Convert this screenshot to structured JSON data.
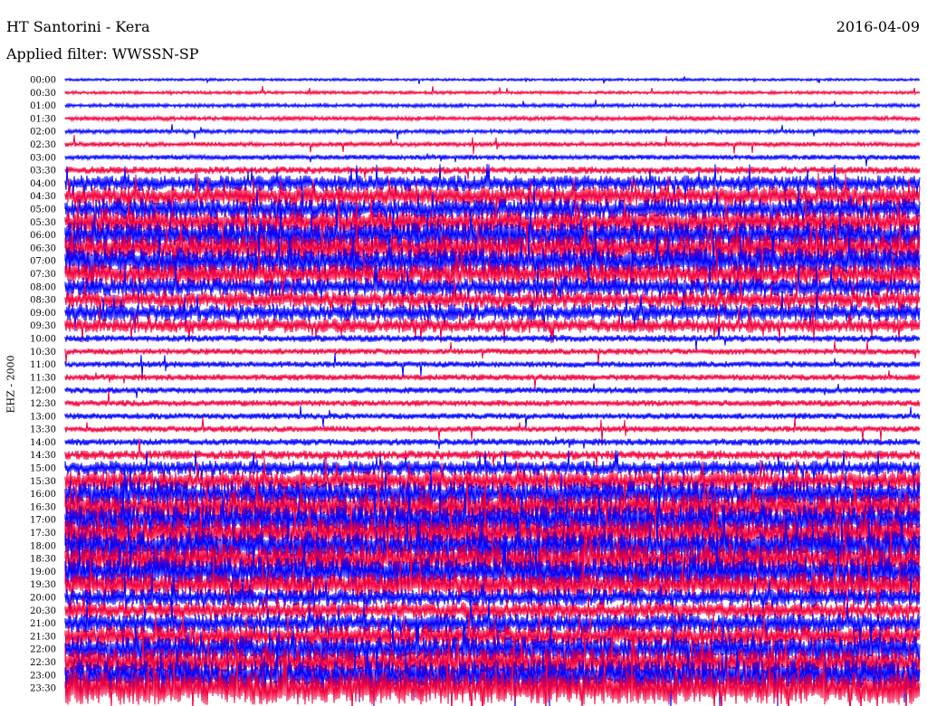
{
  "header": {
    "title": "HT Santorini - Kera",
    "date": "2016-04-09",
    "filter": "Applied filter: WWSSN-SP"
  },
  "chart_data": {
    "type": "line",
    "title": "HT Santorini - Kera",
    "ylabel": "EHZ - 2000",
    "colors": {
      "odd": "#0000ff",
      "even": "#f2003c"
    },
    "rows": [
      {
        "label": "00:00",
        "amp": 0.05
      },
      {
        "label": "00:30",
        "amp": 0.1
      },
      {
        "label": "01:00",
        "amp": 0.15
      },
      {
        "label": "01:30",
        "amp": 0.2
      },
      {
        "label": "02:00",
        "amp": 0.2
      },
      {
        "label": "02:30",
        "amp": 0.22
      },
      {
        "label": "03:00",
        "amp": 0.25
      },
      {
        "label": "03:30",
        "amp": 0.45
      },
      {
        "label": "04:00",
        "amp": 1.1
      },
      {
        "label": "04:30",
        "amp": 1.4
      },
      {
        "label": "05:00",
        "amp": 1.5
      },
      {
        "label": "05:30",
        "amp": 1.7
      },
      {
        "label": "06:00",
        "amp": 1.9
      },
      {
        "label": "06:30",
        "amp": 2.0
      },
      {
        "label": "07:00",
        "amp": 2.0
      },
      {
        "label": "07:30",
        "amp": 1.6
      },
      {
        "label": "08:00",
        "amp": 1.3
      },
      {
        "label": "08:30",
        "amp": 1.2
      },
      {
        "label": "09:00",
        "amp": 1.2
      },
      {
        "label": "09:30",
        "amp": 1.0
      },
      {
        "label": "10:00",
        "amp": 0.4
      },
      {
        "label": "10:30",
        "amp": 0.35
      },
      {
        "label": "11:00",
        "amp": 0.35
      },
      {
        "label": "11:30",
        "amp": 0.35
      },
      {
        "label": "12:00",
        "amp": 0.35
      },
      {
        "label": "12:30",
        "amp": 0.35
      },
      {
        "label": "13:00",
        "amp": 0.35
      },
      {
        "label": "13:30",
        "amp": 0.35
      },
      {
        "label": "14:00",
        "amp": 0.4
      },
      {
        "label": "14:30",
        "amp": 0.6
      },
      {
        "label": "15:00",
        "amp": 1.0
      },
      {
        "label": "15:30",
        "amp": 1.5
      },
      {
        "label": "16:00",
        "amp": 1.9
      },
      {
        "label": "16:30",
        "amp": 2.1
      },
      {
        "label": "17:00",
        "amp": 2.2
      },
      {
        "label": "17:30",
        "amp": 2.2
      },
      {
        "label": "18:00",
        "amp": 2.2
      },
      {
        "label": "18:30",
        "amp": 2.2
      },
      {
        "label": "19:00",
        "amp": 2.2
      },
      {
        "label": "19:30",
        "amp": 1.8
      },
      {
        "label": "20:00",
        "amp": 1.2
      },
      {
        "label": "20:30",
        "amp": 1.2
      },
      {
        "label": "21:00",
        "amp": 1.4
      },
      {
        "label": "21:30",
        "amp": 1.6
      },
      {
        "label": "22:00",
        "amp": 1.9
      },
      {
        "label": "22:30",
        "amp": 2.1
      },
      {
        "label": "23:00",
        "amp": 2.3
      },
      {
        "label": "23:30",
        "amp": 2.5
      }
    ]
  }
}
